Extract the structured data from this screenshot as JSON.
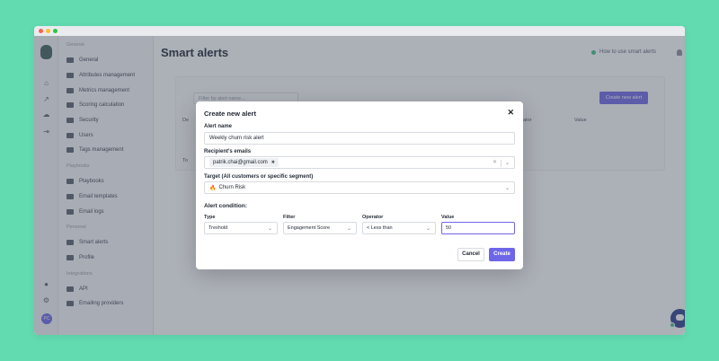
{
  "colors": {
    "accent": "#6e66e8",
    "background": "#62dbb1",
    "online": "#3cc48a"
  },
  "sidebar": {
    "sections": [
      {
        "title": "General",
        "items": [
          {
            "label": "General",
            "icon": "globe-icon"
          },
          {
            "label": "Attributes management",
            "icon": "sliders-icon"
          },
          {
            "label": "Metrics management",
            "icon": "ruler-icon"
          },
          {
            "label": "Scoring calculation",
            "icon": "calculator-icon"
          },
          {
            "label": "Security",
            "icon": "shield-icon"
          },
          {
            "label": "Users",
            "icon": "users-icon"
          },
          {
            "label": "Tags management",
            "icon": "tag-icon"
          }
        ]
      },
      {
        "title": "Playbooks",
        "items": [
          {
            "label": "Playbooks",
            "icon": "book-icon"
          },
          {
            "label": "Email templates",
            "icon": "mail-icon"
          },
          {
            "label": "Email logs",
            "icon": "log-icon"
          }
        ]
      },
      {
        "title": "Personal",
        "items": [
          {
            "label": "Smart alerts",
            "icon": "bell-icon"
          },
          {
            "label": "Profile",
            "icon": "user-icon"
          }
        ]
      },
      {
        "title": "Integrations",
        "items": [
          {
            "label": "API",
            "icon": "api-icon"
          },
          {
            "label": "Emailing providers",
            "icon": "send-icon"
          }
        ]
      }
    ]
  },
  "user": {
    "initials": "PC"
  },
  "page": {
    "title": "Smart alerts",
    "howto": "How to use smart alerts",
    "filter_placeholder": "Filter by alert name...",
    "new_alert": "Create new alert",
    "col_operator": "ator",
    "col_value": "Value",
    "col_de": "De",
    "col_to": "To"
  },
  "modal": {
    "title": "Create new alert",
    "name_label": "Alert name",
    "name_value": "Weekly churn risk alert",
    "recipients_label": "Recipient's emails",
    "recipient": "patrik.chai@gmail.com",
    "target_label": "Target (All customers or specific segment)",
    "target_value": "Churn Risk",
    "condition_label": "Alert condition:",
    "type_label": "Type",
    "type_value": "Treshold",
    "filter_label": "Filter",
    "filter_value": "Engagement Score",
    "operator_label": "Operator",
    "operator_value": "< Less than",
    "value_label": "Value",
    "value_value": "50",
    "cancel": "Cancel",
    "create": "Create"
  }
}
